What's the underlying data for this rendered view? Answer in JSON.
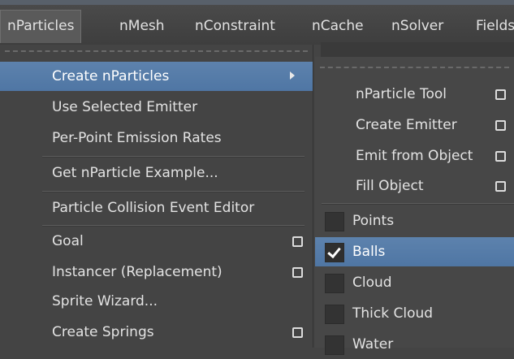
{
  "menubar": {
    "items": [
      "nParticles",
      "nMesh",
      "nConstraint",
      "nCache",
      "nSolver",
      "Fields"
    ]
  },
  "left_menu": {
    "items": [
      {
        "label": "Create nParticles",
        "submenu": true,
        "highlighted": true
      },
      {
        "label": "Use Selected Emitter"
      },
      {
        "label": "Per-Point Emission Rates"
      },
      {
        "label": "Get nParticle Example..."
      },
      {
        "label": "Particle Collision Event Editor"
      },
      {
        "label": "Goal",
        "option_box": true
      },
      {
        "label": "Instancer (Replacement)",
        "option_box": true
      },
      {
        "label": "Sprite Wizard..."
      },
      {
        "label": "Create Springs",
        "option_box": true
      }
    ]
  },
  "right_menu": {
    "items": [
      {
        "label": "nParticle Tool",
        "option_box": true
      },
      {
        "label": "Create Emitter",
        "option_box": true
      },
      {
        "label": "Emit from Object",
        "option_box": true
      },
      {
        "label": "Fill Object",
        "option_box": true
      }
    ],
    "styles": [
      {
        "label": "Points",
        "checked": false
      },
      {
        "label": "Balls",
        "checked": true
      },
      {
        "label": "Cloud",
        "checked": false
      },
      {
        "label": "Thick Cloud",
        "checked": false
      },
      {
        "label": "Water",
        "checked": false
      }
    ]
  },
  "colors": {
    "highlight": "#5479a7",
    "menu_bg": "#444444"
  }
}
